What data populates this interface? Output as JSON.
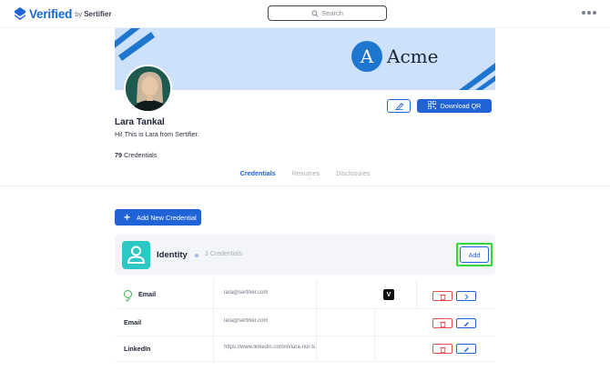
{
  "header": {
    "logo_text": "Verified",
    "logo_by": "by",
    "logo_brand": "Sertifier",
    "search_placeholder": "Search",
    "more_icon": "more-dots-icon"
  },
  "profile": {
    "company_initial": "A",
    "company_name": "Acme",
    "name": "Lara Tankal",
    "bio": "Hi! This is Lara from Sertifier.",
    "credential_count": "79",
    "credential_count_label": "Credentials",
    "download_qr_label": "Download QR"
  },
  "tabs": [
    {
      "label": "Credentials",
      "active": true
    },
    {
      "label": "Resumes",
      "active": false
    },
    {
      "label": "Disclosures",
      "active": false
    }
  ],
  "actions": {
    "add_new_credential_label": "Add New Credential"
  },
  "section": {
    "title": "Identity",
    "count": "3 Credentials",
    "add_label": "Add"
  },
  "rows": [
    {
      "label": "Email",
      "value": "lara@sertifier.com",
      "verified": true
    },
    {
      "label": "Email",
      "value": "lara@sertifier.com",
      "verified": false
    },
    {
      "label": "LinkedIn",
      "value": "https://www.linkedin.com/in/lara-nur-tar",
      "verified": false
    }
  ],
  "colors": {
    "primary": "#1f63d6",
    "banner": "#cde2fa",
    "highlight": "#39d63a",
    "danger": "#e05050",
    "teal": "#2cc8c6"
  }
}
